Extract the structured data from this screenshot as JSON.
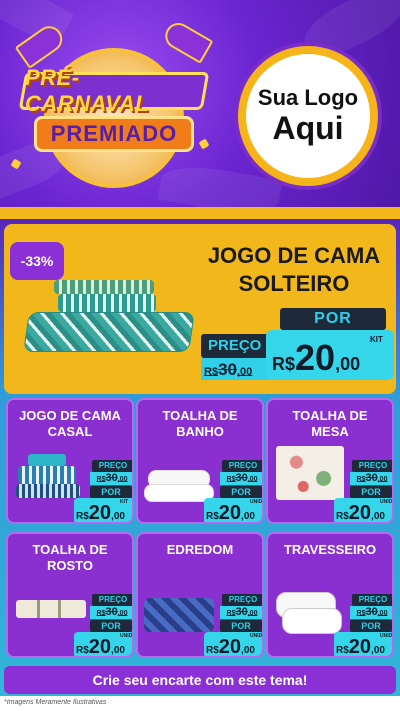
{
  "header": {
    "badge_line1": "PRÉ-CARNAVAL",
    "badge_line2": "PREMIADO",
    "logo_line1": "Sua Logo",
    "logo_line2": "Aqui"
  },
  "featured": {
    "discount": "-33%",
    "title_line1": "JOGO DE CAMA",
    "title_line2": "SOLTEIRO",
    "preco_label": "PREÇO",
    "old_currency": "R$",
    "old_price": "30",
    "old_cents": ",00",
    "por_label": "POR",
    "new_currency": "R$",
    "new_price": "20",
    "new_cents": ",00",
    "unit": "KIT"
  },
  "cards": [
    {
      "title": "JOGO DE CAMA CASAL",
      "preco_label": "PREÇO",
      "old_currency": "R$",
      "old_price": "30",
      "old_cents": ",00",
      "por_label": "POR",
      "new_currency": "R$",
      "new_price": "20",
      "new_cents": ",00",
      "unit": "KIT"
    },
    {
      "title": "TOALHA DE BANHO",
      "preco_label": "PREÇO",
      "old_currency": "R$",
      "old_price": "30",
      "old_cents": ",00",
      "por_label": "POR",
      "new_currency": "R$",
      "new_price": "20",
      "new_cents": ",00",
      "unit": "UNID"
    },
    {
      "title": "TOALHA DE MESA",
      "preco_label": "PREÇO",
      "old_currency": "R$",
      "old_price": "30",
      "old_cents": ",00",
      "por_label": "POR",
      "new_currency": "R$",
      "new_price": "20",
      "new_cents": ",00",
      "unit": "UNID"
    },
    {
      "title": "TOALHA DE ROSTO",
      "preco_label": "PREÇO",
      "old_currency": "R$",
      "old_price": "30",
      "old_cents": ",00",
      "por_label": "POR",
      "new_currency": "R$",
      "new_price": "20",
      "new_cents": ",00",
      "unit": "UNID"
    },
    {
      "title": "EDREDOM",
      "preco_label": "PREÇO",
      "old_currency": "R$",
      "old_price": "30",
      "old_cents": ",00",
      "por_label": "POR",
      "new_currency": "R$",
      "new_price": "20",
      "new_cents": ",00",
      "unit": "UNID"
    },
    {
      "title": "TRAVESSEIRO",
      "preco_label": "PREÇO",
      "old_currency": "R$",
      "old_price": "30",
      "old_cents": ",00",
      "por_label": "POR",
      "new_currency": "R$",
      "new_price": "20",
      "new_cents": ",00",
      "unit": "UNID"
    }
  ],
  "footer": {
    "cta": "Crie seu encarte com este tema!",
    "note": "*Imagens Meramente Ilustrativas"
  },
  "colors": {
    "purple": "#8b2fd6",
    "gold": "#f2b81b",
    "cyan": "#36d6ea",
    "dark": "#1e2a3a"
  }
}
